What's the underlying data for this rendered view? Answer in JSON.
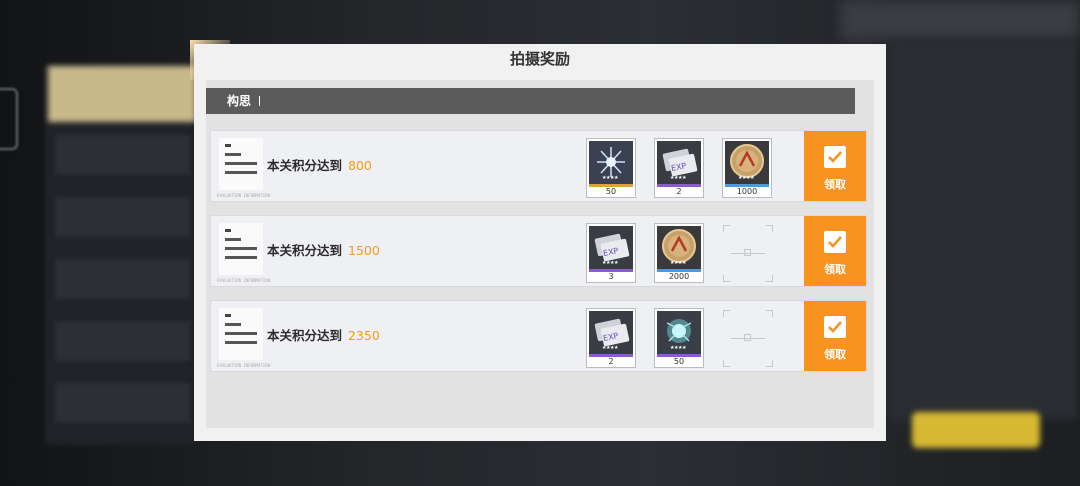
{
  "dialog": {
    "title": "拍摄奖励",
    "section_title": "构思"
  },
  "rows": [
    {
      "label": "本关积分达到",
      "score": "800",
      "tag": "EVALUATION INFORMATION",
      "claim_label": "领取",
      "rewards": [
        {
          "icon": "crystal-shard-icon",
          "rarity": "gold",
          "quantity": "50"
        },
        {
          "icon": "exp-card-icon",
          "rarity": "purple",
          "quantity": "2"
        },
        {
          "icon": "gold-coin-icon",
          "rarity": "blue",
          "quantity": "1000"
        }
      ]
    },
    {
      "label": "本关积分达到",
      "score": "1500",
      "tag": "EVALUATION INFORMATION",
      "claim_label": "领取",
      "rewards": [
        {
          "icon": "exp-card-icon",
          "rarity": "purple",
          "quantity": "3"
        },
        {
          "icon": "gold-coin-icon",
          "rarity": "blue",
          "quantity": "2000"
        }
      ]
    },
    {
      "label": "本关积分达到",
      "score": "2350",
      "tag": "EVALUATION INFORMATION",
      "claim_label": "领取",
      "rewards": [
        {
          "icon": "exp-card-icon",
          "rarity": "purple",
          "quantity": "2"
        },
        {
          "icon": "energy-orb-icon",
          "rarity": "purple",
          "quantity": "50"
        }
      ]
    }
  ],
  "colors": {
    "accent": "#f7931e",
    "score": "#f59a1b",
    "rarity_gold": "#e0a23a",
    "rarity_purple": "#8a5cd0",
    "rarity_blue": "#4a9adf"
  }
}
